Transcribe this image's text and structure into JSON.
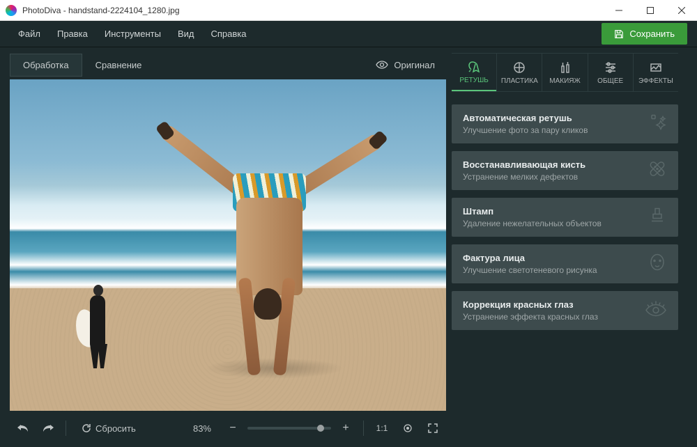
{
  "title": "PhotoDiva - handstand-2224104_1280.jpg",
  "menu": {
    "file": "Файл",
    "edit": "Правка",
    "tools": "Инструменты",
    "view": "Вид",
    "help": "Справка"
  },
  "save": "Сохранить",
  "lefttabs": {
    "process": "Обработка",
    "compare": "Сравнение"
  },
  "original": "Оригинал",
  "reset": "Сбросить",
  "zoom": "83%",
  "oneone": "1:1",
  "righttabs": {
    "retouch": "РЕТУШЬ",
    "plastic": "ПЛАСТИКА",
    "makeup": "МАКИЯЖ",
    "general": "ОБЩЕЕ",
    "effects": "ЭФФЕКТЫ"
  },
  "panels": [
    {
      "title": "Автоматическая ретушь",
      "desc": "Улучшение фото за пару кликов"
    },
    {
      "title": "Восстанавливающая кисть",
      "desc": "Устранение мелких дефектов"
    },
    {
      "title": "Штамп",
      "desc": "Удаление нежелательных объектов"
    },
    {
      "title": "Фактура лица",
      "desc": "Улучшение светотеневого рисунка"
    },
    {
      "title": "Коррекция красных глаз",
      "desc": "Устранение эффекта красных глаз"
    }
  ]
}
